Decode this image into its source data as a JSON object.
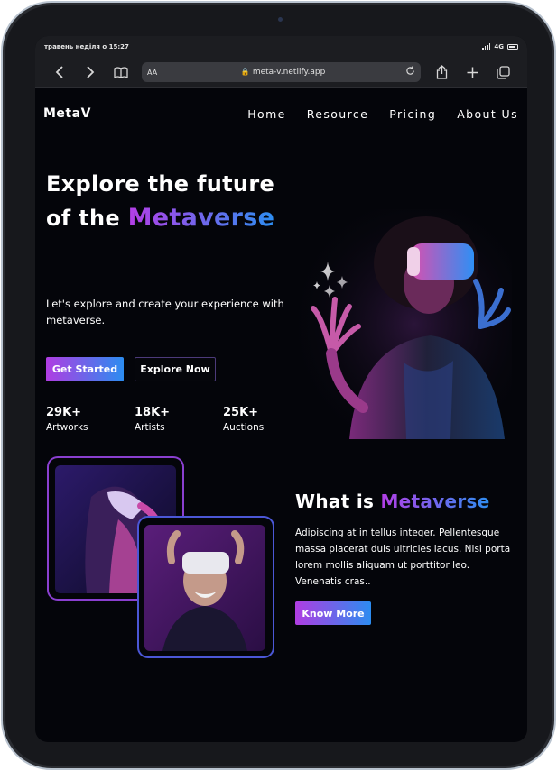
{
  "status_bar": {
    "time_text": "травень неділя о 15:27",
    "network": "4G"
  },
  "browser": {
    "text_size_label": "AA",
    "url": "meta-v.netlify.app",
    "icons": [
      "back-icon",
      "forward-icon",
      "bookmarks-icon",
      "lock-icon",
      "reload-icon",
      "share-icon",
      "new-tab-icon",
      "tabs-icon"
    ]
  },
  "nav": {
    "logo": "MetaV",
    "links": [
      "Home",
      "Resource",
      "Pricing",
      "About Us"
    ]
  },
  "hero": {
    "title_line1": "Explore the future",
    "title_line2_prefix": "of the",
    "title_highlight": "Metaverse",
    "subtitle": "Let's explore and create your experience with metaverse.",
    "primary_button": "Get Started",
    "secondary_button": "Explore Now",
    "stats": [
      {
        "value": "29K+",
        "label": "Artworks"
      },
      {
        "value": "18K+",
        "label": "Artists"
      },
      {
        "value": "25K+",
        "label": "Auctions"
      }
    ]
  },
  "about": {
    "title_prefix": "What is",
    "title_highlight": "Metaverse",
    "text": "Adipiscing at in tellus integer. Pellentesque massa placerat duis ultricies lacus. Nisi porta lorem mollis aliquam ut porttitor leo. Venenatis cras..",
    "button": "Know More"
  },
  "colors": {
    "background": "#04050a",
    "gradient_start": "#b03de2",
    "gradient_end": "#2c8cf0",
    "text": "#ffffff"
  }
}
